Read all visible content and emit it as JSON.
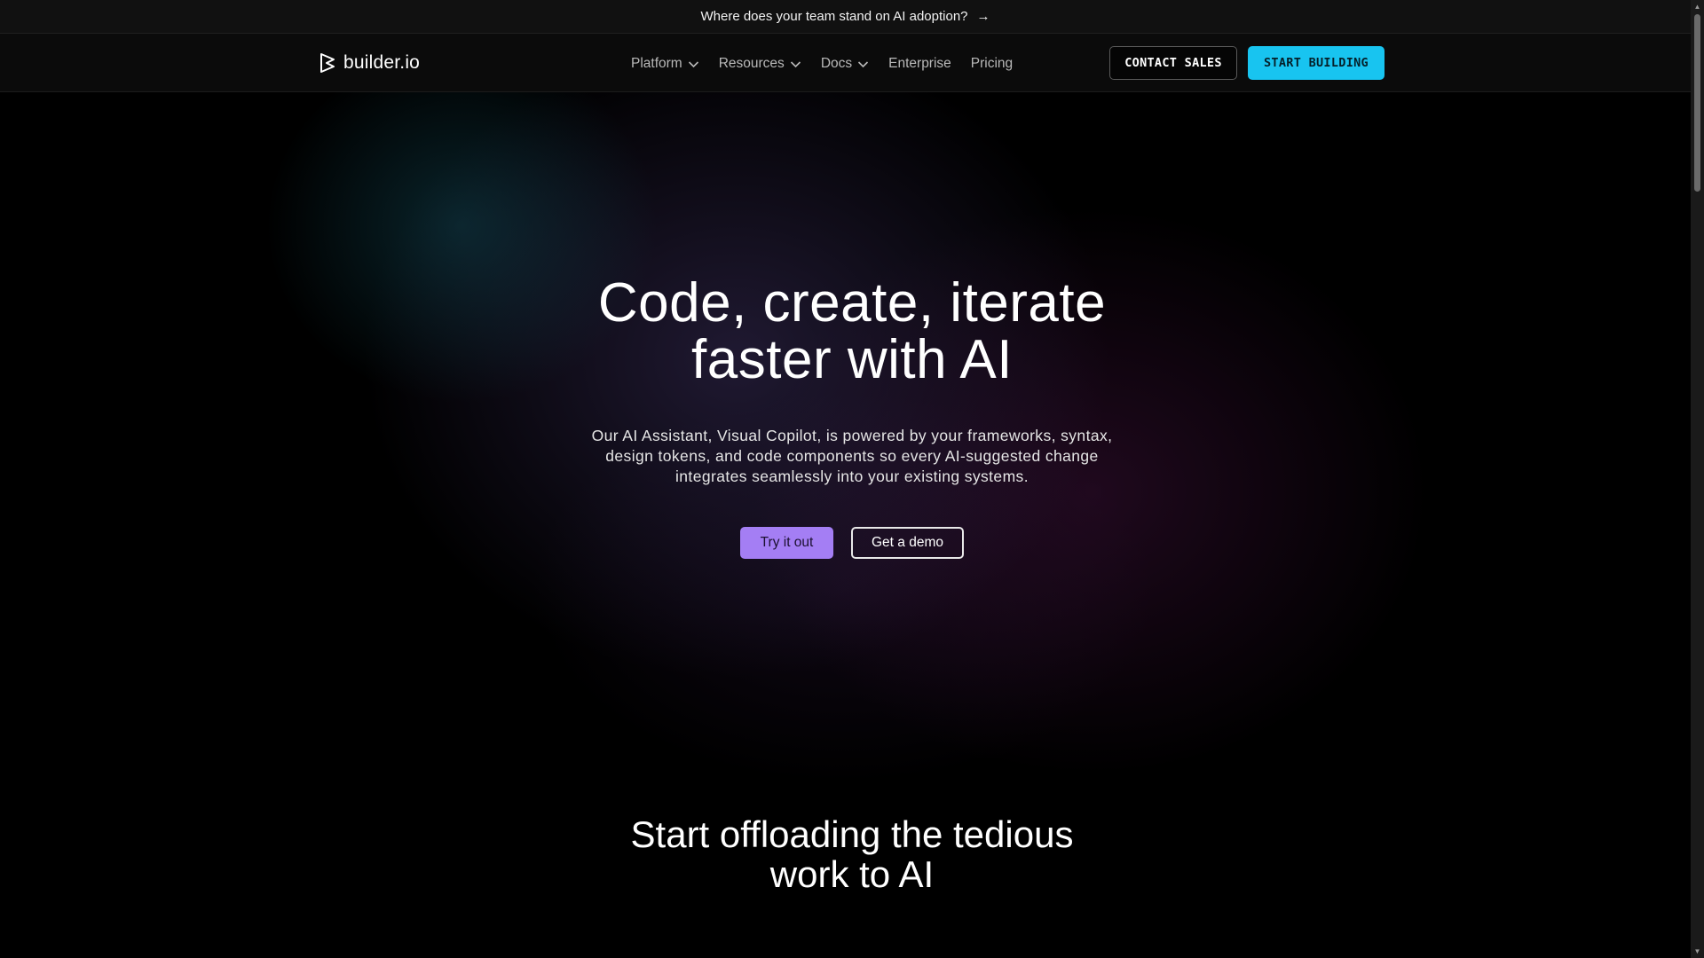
{
  "announcement": {
    "text": "Where does your team stand on AI adoption?",
    "arrow": "→"
  },
  "nav": {
    "logo_text": "builder.io",
    "menu": [
      {
        "label": "Platform",
        "has_dropdown": true
      },
      {
        "label": "Resources",
        "has_dropdown": true
      },
      {
        "label": "Docs",
        "has_dropdown": true
      },
      {
        "label": "Enterprise",
        "has_dropdown": false
      },
      {
        "label": "Pricing",
        "has_dropdown": false
      }
    ],
    "contact_sales": "CONTACT SALES",
    "start_building": "START BUILDING"
  },
  "hero": {
    "title_line1": "Code, create, iterate",
    "title_line2": "faster with AI",
    "subtitle_line1": "Our AI Assistant, Visual Copilot, is powered by your frameworks, syntax,",
    "subtitle_line2": "design tokens, and code components so every AI-suggested change",
    "subtitle_line3": "integrates seamlessly into your existing systems.",
    "try_button": "Try it out",
    "demo_button": "Get a demo"
  },
  "section": {
    "title_line1": "Start offloading the tedious",
    "title_line2": "work to AI"
  },
  "colors": {
    "accent_cyan": "#18c4f0",
    "accent_purple": "#a47ef4",
    "background": "#000000"
  }
}
